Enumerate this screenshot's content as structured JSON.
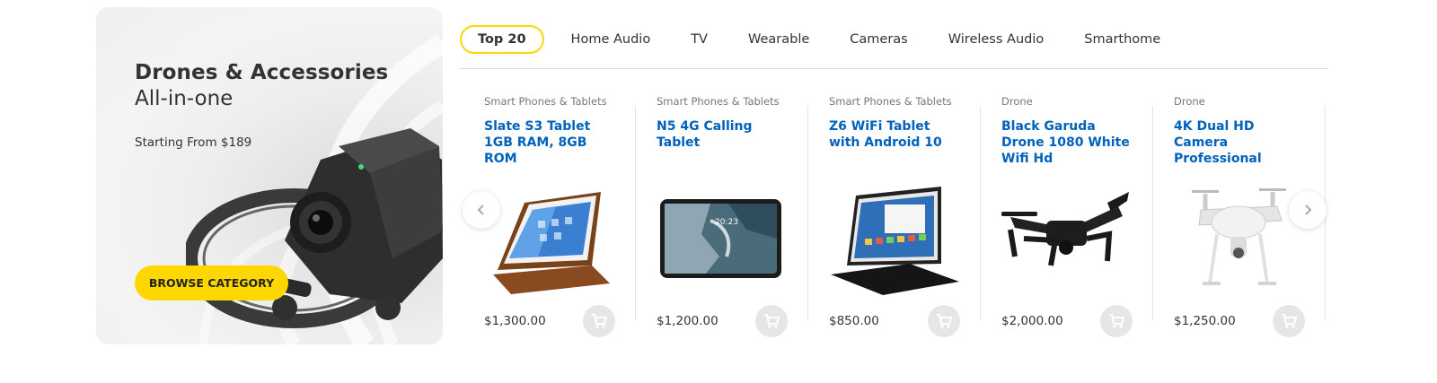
{
  "promo": {
    "title": "Drones & Accessories",
    "subtitle": "All-in-one",
    "price_text": "Starting From $189",
    "button_label": "BROWSE CATEGORY"
  },
  "tabs": [
    {
      "label": "Top 20",
      "active": true
    },
    {
      "label": "Home Audio"
    },
    {
      "label": "TV"
    },
    {
      "label": "Wearable"
    },
    {
      "label": "Cameras"
    },
    {
      "label": "Wireless Audio"
    },
    {
      "label": "Smarthome"
    }
  ],
  "products": [
    {
      "category": "Smart Phones & Tablets",
      "name": "Slate S3 Tablet 1GB RAM, 8GB ROM",
      "price": "$1,300.00",
      "image": "tablet-with-case"
    },
    {
      "category": "Smart Phones & Tablets",
      "name": "N5 4G Calling Tablet",
      "price": "$1,200.00",
      "image": "tablet-landscape"
    },
    {
      "category": "Smart Phones & Tablets",
      "name": "Z6 WiFi Tablet with Android 10",
      "price": "$850.00",
      "image": "tablet-on-stand"
    },
    {
      "category": "Drone",
      "name": "Black Garuda Drone 1080 White Wifi Hd",
      "price": "$2,000.00",
      "image": "black-drone"
    },
    {
      "category": "Drone",
      "name": "4K Dual HD Camera Professional",
      "price": "$1,250.00",
      "image": "white-drone"
    }
  ],
  "tablet_screen_time": "20:23",
  "colors": {
    "accent": "#fed700",
    "link": "#0062bd"
  },
  "icons": {
    "cart": "cart-icon",
    "prev": "chevron-left-icon",
    "next": "chevron-right-icon"
  }
}
